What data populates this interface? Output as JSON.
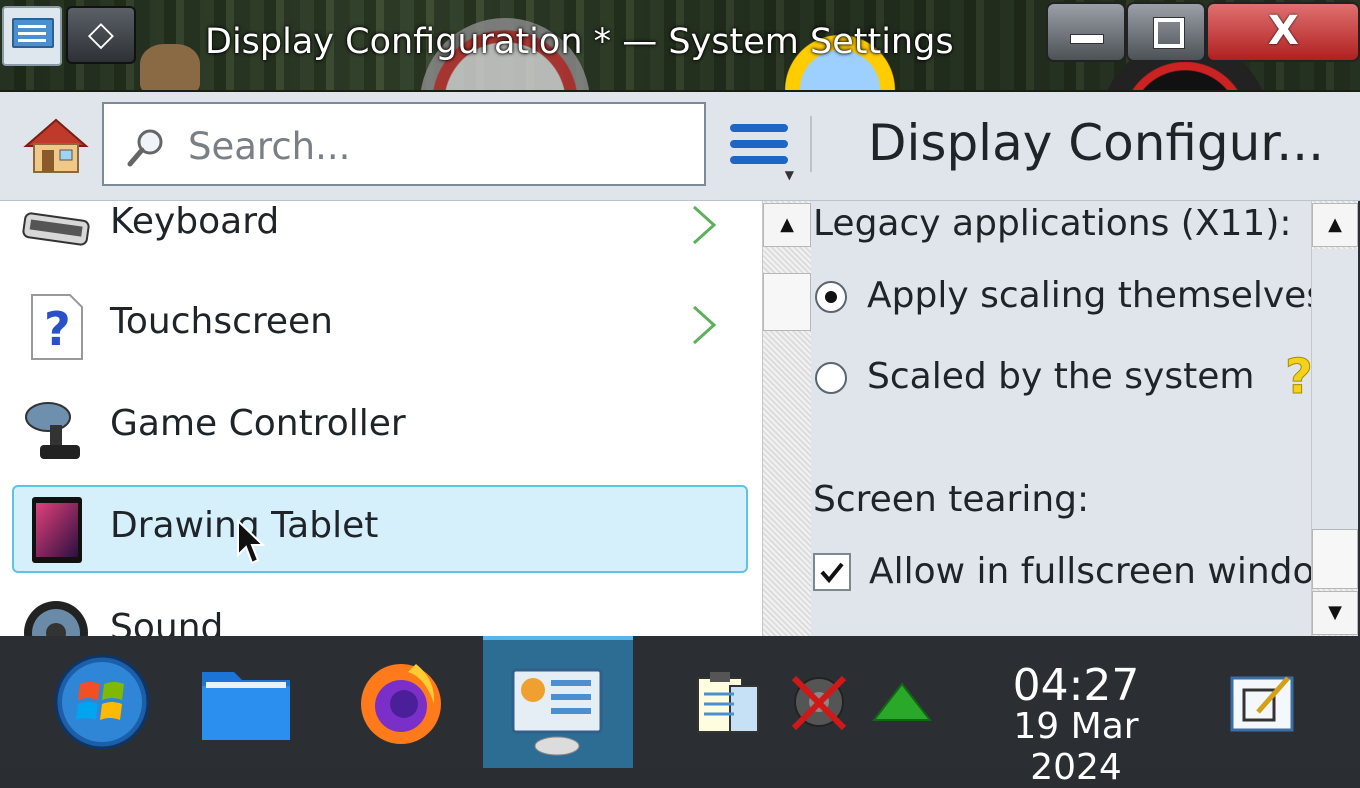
{
  "window": {
    "title": "Display Configuration * — System Settings",
    "buttons": [
      "minimize",
      "maximize",
      "close"
    ],
    "close_glyph": "X"
  },
  "toolbar": {
    "home_icon": "home-icon",
    "search_placeholder": "Search...",
    "search_value": "",
    "menu_icon": "hamburger-menu-icon",
    "page_title": "Display Configur..."
  },
  "categories": [
    {
      "label": "Keyboard",
      "icon": "keyboard-icon",
      "has_children": true
    },
    {
      "label": "Touchscreen",
      "icon": "touchscreen-icon",
      "has_children": true
    },
    {
      "label": "Game Controller",
      "icon": "game-controller-icon",
      "has_children": false
    },
    {
      "label": "Drawing Tablet",
      "icon": "drawing-tablet-icon",
      "has_children": false,
      "selected": true
    },
    {
      "label": "Sound",
      "icon": "sound-icon",
      "has_children": false
    }
  ],
  "settings": {
    "legacy_label": "Legacy applications (X11):",
    "option_apply": "Apply scaling themselves",
    "option_scaled": "Scaled by the system",
    "option_apply_selected": true,
    "tearing_label": "Screen tearing:",
    "allow_fullscreen": "Allow in fullscreen windows",
    "allow_fullscreen_checked": true
  },
  "taskbar": {
    "items": [
      "start-menu",
      "file-manager",
      "firefox",
      "system-settings"
    ],
    "active": "system-settings",
    "tray": [
      "clipboard-icon",
      "audio-muted-icon",
      "network-icon"
    ],
    "time": "04:27",
    "date": "19 Mar 2024"
  },
  "colors": {
    "selection_bg": "#d6f0fb",
    "selection_border": "#5ec4e6",
    "accent": "#1e66c6",
    "taskbar_active": "#2e6d93"
  }
}
